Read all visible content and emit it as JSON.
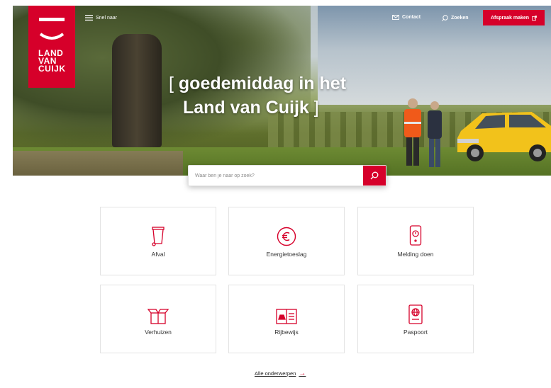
{
  "header": {
    "menu_label": "Snel naar",
    "contact_label": "Contact",
    "search_label": "Zoeken",
    "appointment_label": "Afspraak maken",
    "logo_lines": [
      "LAND",
      "VAN",
      "CUIJK"
    ]
  },
  "hero": {
    "greeting_bracket_open": "[",
    "greeting_line1": "goedemiddag in het",
    "greeting_line2": "Land van Cuijk",
    "greeting_bracket_close": "]"
  },
  "search": {
    "placeholder": "Waar ben je naar op zoek?"
  },
  "tiles": [
    {
      "label": "Afval",
      "icon": "trash-bin-icon"
    },
    {
      "label": "Energietoeslag",
      "icon": "euro-icon"
    },
    {
      "label": "Melding doen",
      "icon": "phone-alert-icon"
    },
    {
      "label": "Verhuizen",
      "icon": "box-icon"
    },
    {
      "label": "Rijbewijs",
      "icon": "license-icon"
    },
    {
      "label": "Paspoort",
      "icon": "passport-icon"
    }
  ],
  "footer_link": {
    "label": "Alle onderwerpen",
    "arrow": "→"
  },
  "colors": {
    "brand_red": "#d6002a"
  }
}
